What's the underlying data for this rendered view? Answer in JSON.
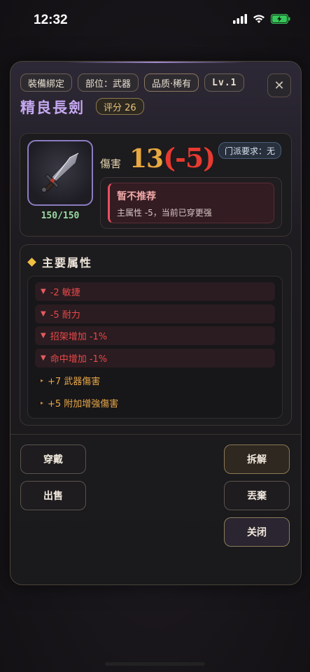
{
  "status_bar": {
    "time": "12:32"
  },
  "header": {
    "tags": [
      "裝備綁定",
      "部位：武器",
      "品质·稀有",
      "Lv.1"
    ],
    "item_name": "精良長劍",
    "score": "评分 26",
    "close_glyph": "✕"
  },
  "item": {
    "durability": "150/150",
    "damage_label": "傷害",
    "damage_value": "13",
    "damage_diff": "(-5)",
    "sect_requirement": "门派要求：无"
  },
  "recommend": {
    "title": "暂不推荐",
    "desc": "主属性 -5，当前已穿更强"
  },
  "attributes": {
    "title": "主要属性",
    "negative": [
      "-2 敏捷",
      "-5 耐力",
      "招架增加 -1%",
      "命中增加 -1%"
    ],
    "positive": [
      "+7 武器傷害",
      "+5 附加增強傷害"
    ]
  },
  "buttons": {
    "equip": "穿戴",
    "sell": "出售",
    "dismantle": "拆解",
    "discard": "丟棄",
    "close": "关闭"
  },
  "colors": {
    "item_name": "#c5a8f0",
    "damage": "#e8a840",
    "damage_diff": "#e83a30",
    "negative": "#e8484a",
    "positive": "#e8a848",
    "durability": "#9ad9a0"
  },
  "icons": [
    "cellular-signal-icon",
    "wifi-icon",
    "battery-charging-icon",
    "close-icon",
    "sword-icon",
    "diamond-icon",
    "triangle-down-icon",
    "triangle-right-icon"
  ]
}
